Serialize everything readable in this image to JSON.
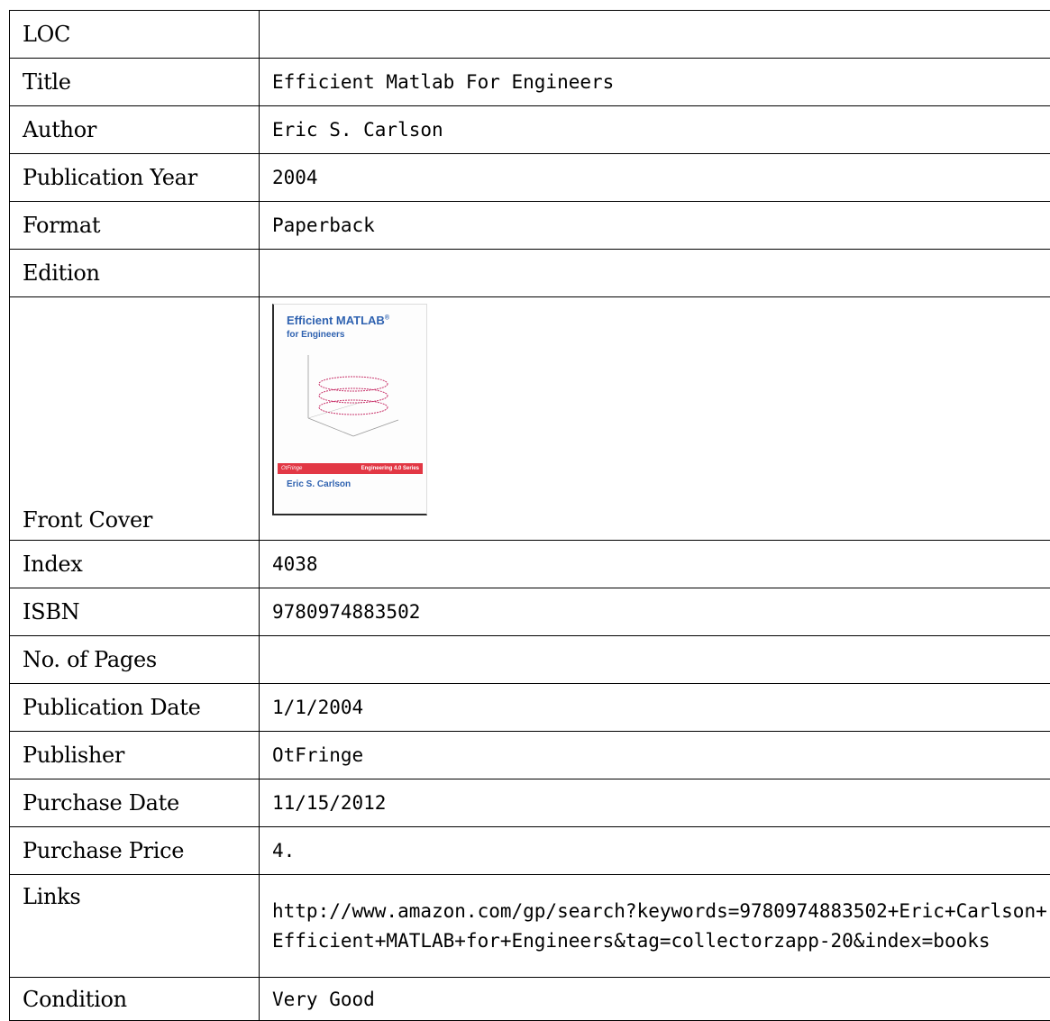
{
  "labels": {
    "loc": "LOC",
    "title": "Title",
    "author": "Author",
    "publication_year": "Publication Year",
    "format": "Format",
    "edition": "Edition",
    "front_cover": "Front Cover",
    "index": "Index",
    "isbn": "ISBN",
    "no_of_pages": "No. of Pages",
    "publication_date": "Publication Date",
    "publisher": "Publisher",
    "purchase_date": "Purchase Date",
    "purchase_price": "Purchase Price",
    "links": "Links",
    "condition": "Condition"
  },
  "values": {
    "loc": "",
    "title": "Efficient Matlab For Engineers",
    "author": "Eric S. Carlson",
    "publication_year": "2004",
    "format": "Paperback",
    "edition": "",
    "index": "4038",
    "isbn": "9780974883502",
    "no_of_pages": "",
    "publication_date": "1/1/2004",
    "publisher": "OtFringe",
    "purchase_date": "11/15/2012",
    "purchase_price": "4.",
    "links": "http://www.amazon.com/gp/search?keywords=9780974883502+Eric+Carlson+Efficient+MATLAB+for+Engineers&tag=collectorzapp-20&index=books",
    "condition": "Very Good"
  },
  "cover": {
    "title_line1": "Efficient MATLAB",
    "registered_mark": "®",
    "title_line2": "for Engineers",
    "band_left": "OtFringe",
    "band_right": "Engineering 4.0 Series",
    "author": "Eric S. Carlson",
    "colors": {
      "title_blue": "#2f62b0",
      "band_red": "#e23744",
      "plot_curve": "#c8336a"
    }
  }
}
